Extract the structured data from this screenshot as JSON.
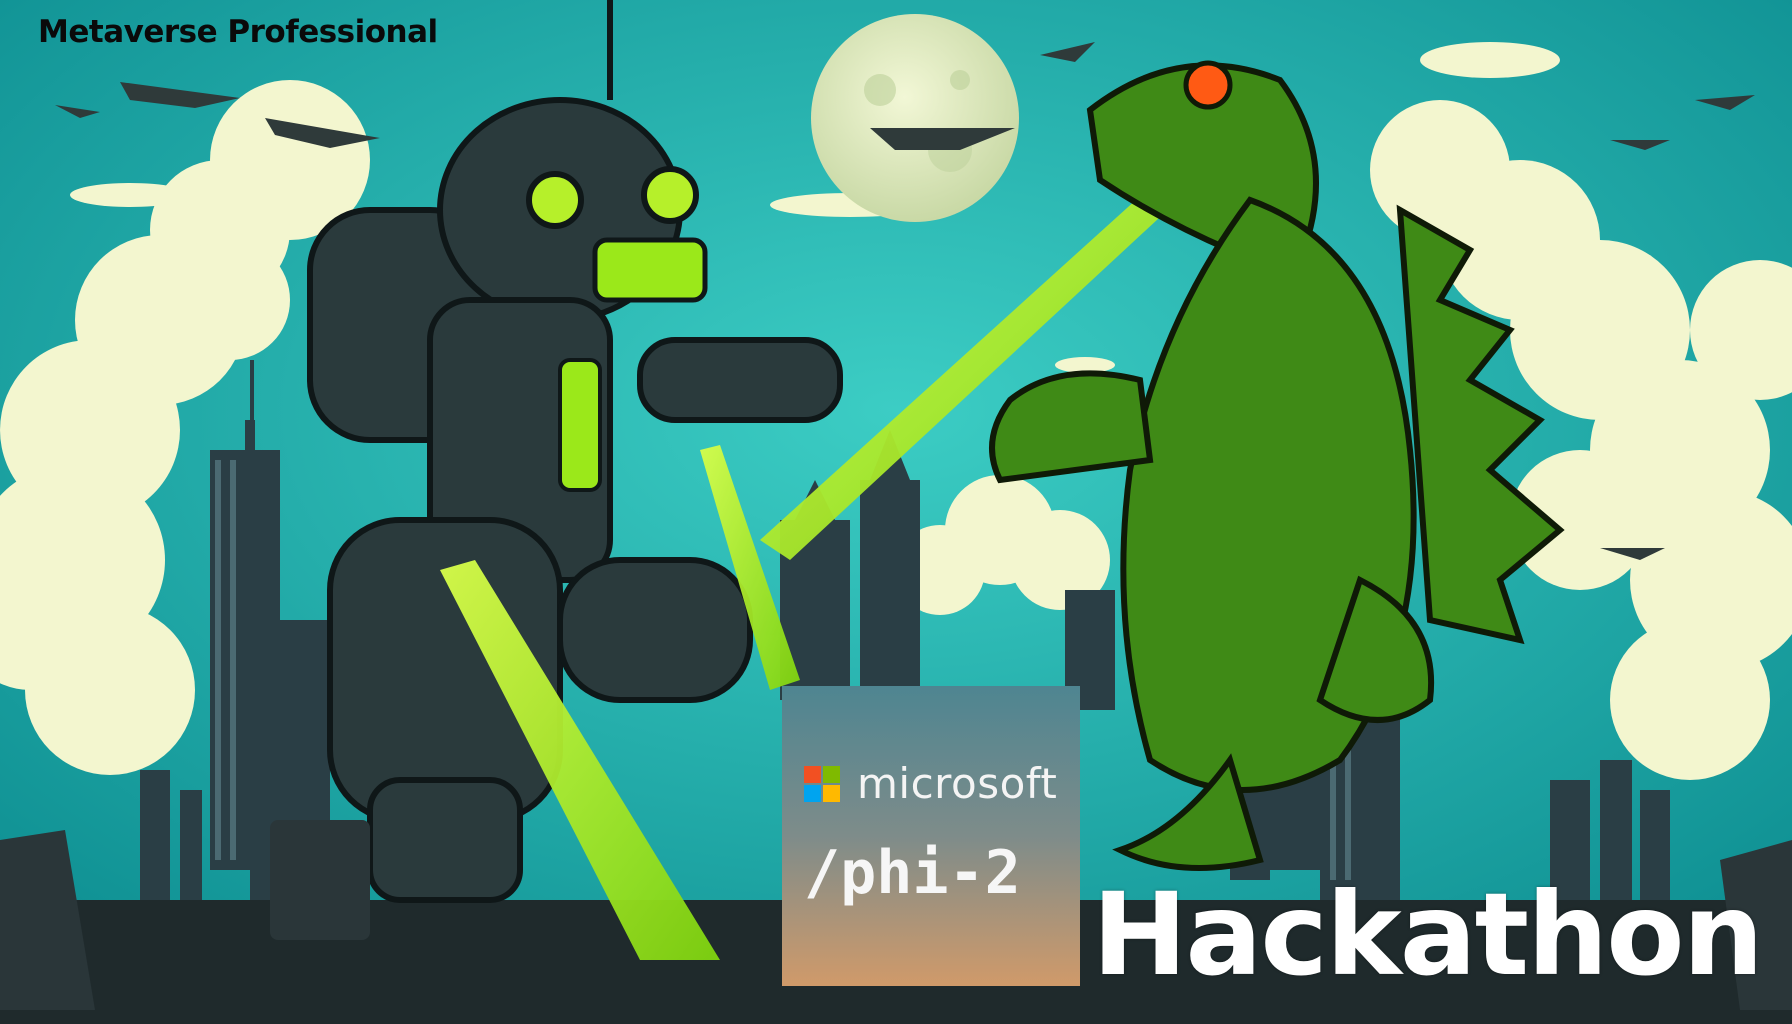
{
  "header": {
    "title": "Metaverse Professional"
  },
  "logo_card": {
    "brand_word": "microsoft",
    "model_name": "/phi-2",
    "logo_colors": [
      "#f25022",
      "#7fba00",
      "#00a4ef",
      "#ffb900"
    ]
  },
  "footer": {
    "event_word": "Hackathon"
  },
  "palette": {
    "sky": "#1fb3ad",
    "clouds": "#f3f6cf",
    "slime": "#9be81a",
    "robot": "#2a3a3c",
    "monster": "#3f8a16"
  }
}
